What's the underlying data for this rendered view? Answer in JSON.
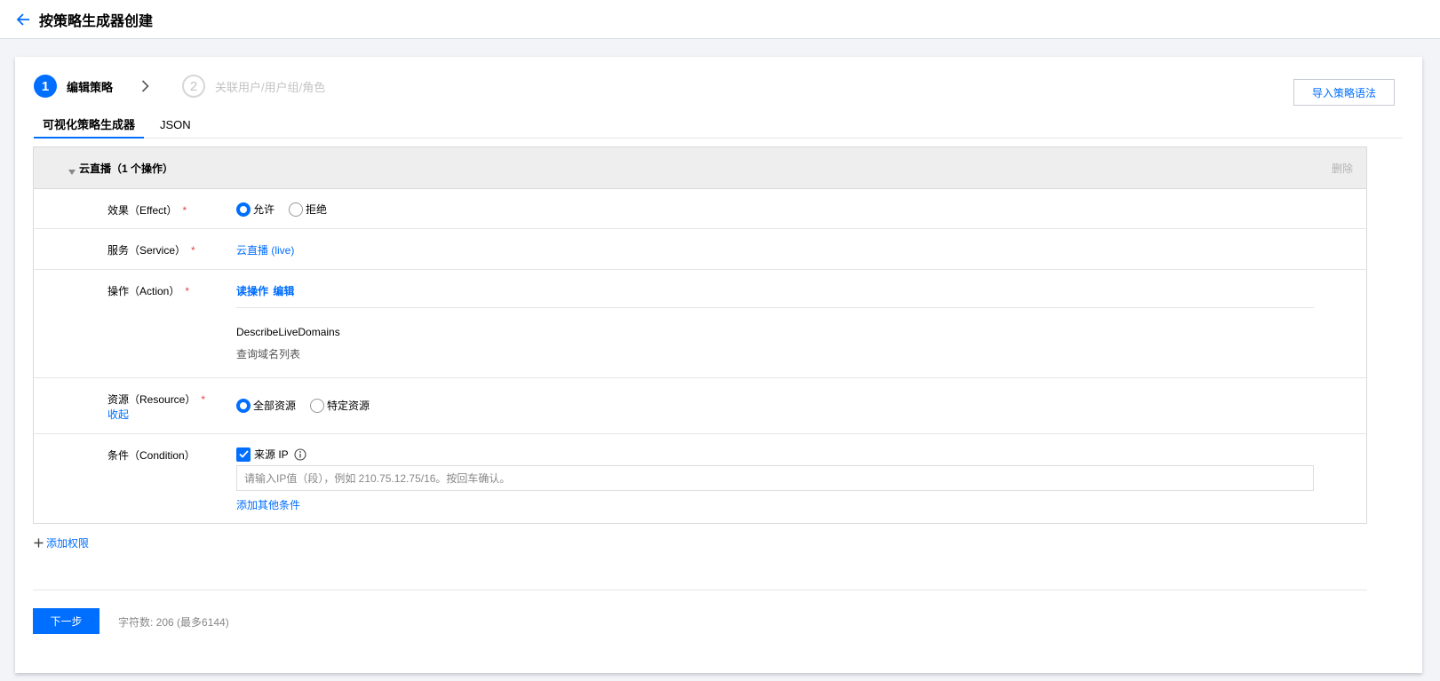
{
  "header": {
    "title": "按策略生成器创建"
  },
  "steps": [
    {
      "num": "1",
      "label": "编辑策略"
    },
    {
      "num": "2",
      "label": "关联用户/用户组/角色"
    }
  ],
  "import_button": "导入策略语法",
  "tabs": [
    {
      "label": "可视化策略生成器"
    },
    {
      "label": "JSON"
    }
  ],
  "panel": {
    "title": "云直播（1 个操作）",
    "delete_label": "删除",
    "effect": {
      "label": "效果（Effect）",
      "required": "*",
      "options": [
        {
          "label": "允许",
          "checked": true
        },
        {
          "label": "拒绝",
          "checked": false
        }
      ]
    },
    "service": {
      "label": "服务（Service）",
      "required": "*",
      "value": "云直播 (live)"
    },
    "action": {
      "label": "操作（Action）",
      "required": "*",
      "read_link": "读操作",
      "edit_link": "编辑",
      "api_name": "DescribeLiveDomains",
      "api_desc": "查询域名列表"
    },
    "resource": {
      "label": "资源（Resource）",
      "required": "*",
      "collapse_link": "收起",
      "options": [
        {
          "label": "全部资源",
          "checked": true
        },
        {
          "label": "特定资源",
          "checked": false
        }
      ]
    },
    "condition": {
      "label": "条件（Condition）",
      "checkbox_label": "来源 IP",
      "checked": true,
      "input_placeholder": "请输入IP值（段），例如 210.75.12.75/16。按回车确认。",
      "input_value": "",
      "add_link": "添加其他条件"
    }
  },
  "add_permission": "添加权限",
  "next_button": "下一步",
  "char_count": "字符数: 206 (最多6144)",
  "colors": {
    "accent": "#006eff",
    "required": "#e54545"
  }
}
